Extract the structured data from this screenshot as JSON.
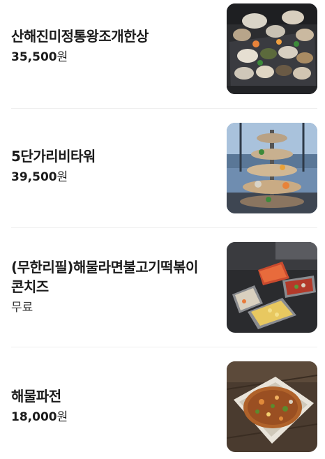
{
  "menu": {
    "items": [
      {
        "name": "산해진미정통왕조개한상",
        "price_amount": "35,500",
        "price_unit": "원",
        "image_icon": "clam-platter-photo"
      },
      {
        "name": "5단가리비타워",
        "price_amount": "39,500",
        "price_unit": "원",
        "image_icon": "scallop-tower-photo"
      },
      {
        "name_line1": "(무한리필)해물라면불고기떡볶이",
        "name_line2": "콘치즈",
        "price_text": "무료",
        "image_icon": "side-dishes-photo"
      },
      {
        "name": "해물파전",
        "price_amount": "18,000",
        "price_unit": "원",
        "image_icon": "seafood-pancake-photo"
      }
    ]
  }
}
